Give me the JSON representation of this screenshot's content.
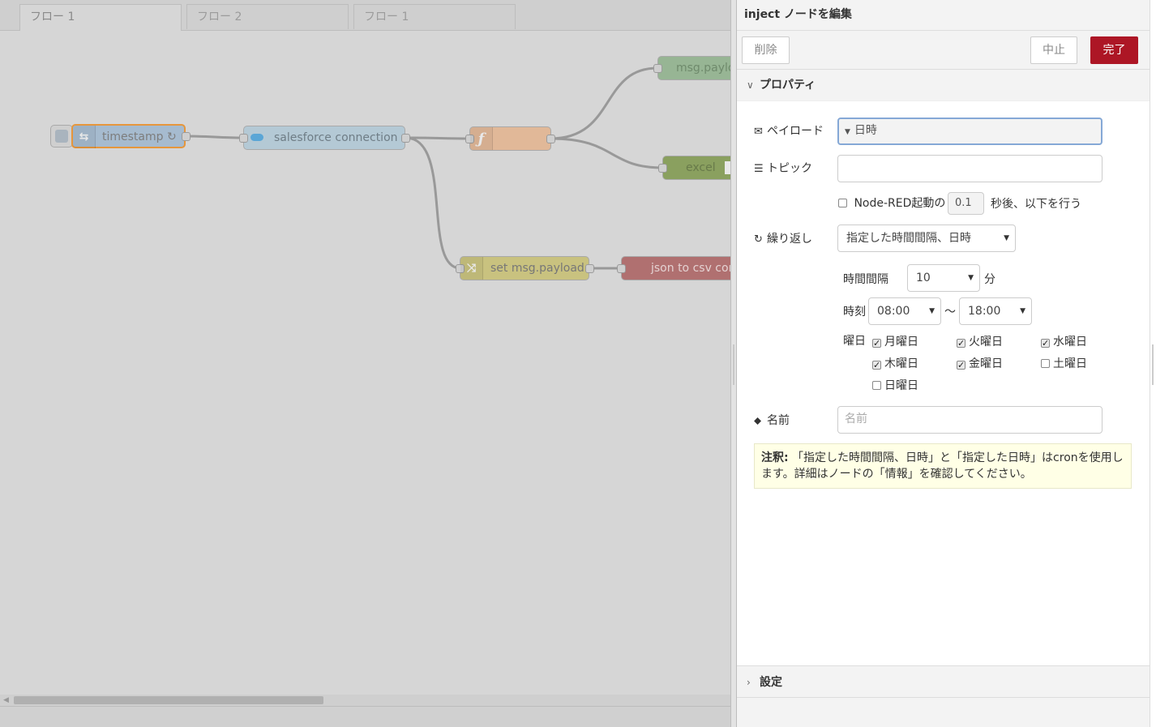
{
  "workspace": {
    "tabs": [
      {
        "label": "フロー 1",
        "active": true
      },
      {
        "label": "フロー 2",
        "active": false
      },
      {
        "label": "フロー 1",
        "active": false
      }
    ],
    "nodes": {
      "timestamp": {
        "label": "timestamp ↻",
        "icon": "inject-arrows-icon",
        "color": "#a6bbcf"
      },
      "salesforce": {
        "label": "salesforce connection",
        "icon": "salesforce-cloud-icon",
        "color": "#b4c9d5"
      },
      "function": {
        "label": "",
        "icon": "function-f-icon",
        "color": "#e1b898"
      },
      "msgpayload": {
        "label": "msg.payloa",
        "color": "#97b594"
      },
      "excel": {
        "label": "excel",
        "color": "#8aa05f"
      },
      "setpayload": {
        "label": "set msg.payload",
        "icon": "shuffle-icon",
        "color": "#c9c27f"
      },
      "jsoncsv": {
        "label": "json to csv conv",
        "color": "#b07070"
      }
    }
  },
  "tray": {
    "title": "inject ノードを編集",
    "buttons": {
      "delete": "削除",
      "cancel": "中止",
      "done": "完了"
    },
    "properties_section": "プロパティ",
    "payload": {
      "label": "ペイロード",
      "value": "日時"
    },
    "topic": {
      "label": "トピック",
      "value": ""
    },
    "once": {
      "prefix": "Node-RED起動の",
      "delay": "0.1",
      "suffix": "秒後、以下を行う",
      "checked": false
    },
    "repeat": {
      "label": "繰り返し",
      "value": "指定した時間間隔、日時"
    },
    "interval": {
      "label": "時間間隔",
      "value": "10",
      "unit": "分"
    },
    "time": {
      "label": "時刻",
      "from": "08:00",
      "tilde": "〜",
      "to": "18:00"
    },
    "days": {
      "label": "曜日",
      "items": [
        {
          "label": "月曜日",
          "checked": true
        },
        {
          "label": "火曜日",
          "checked": true
        },
        {
          "label": "水曜日",
          "checked": true
        },
        {
          "label": "木曜日",
          "checked": true
        },
        {
          "label": "金曜日",
          "checked": true
        },
        {
          "label": "土曜日",
          "checked": false
        },
        {
          "label": "日曜日",
          "checked": false
        }
      ]
    },
    "name": {
      "label": "名前",
      "placeholder": "名前",
      "value": ""
    },
    "note": {
      "bold": "注釈:",
      "text": " 「指定した時間間隔、日時」と「指定した日時」はcronを使用します。詳細はノードの「情報」を確認してください。"
    },
    "settings_section": "設定"
  },
  "colors": {
    "primary": "#ad1625",
    "focus": "#85a8d6",
    "note_bg": "#ffffe6"
  }
}
